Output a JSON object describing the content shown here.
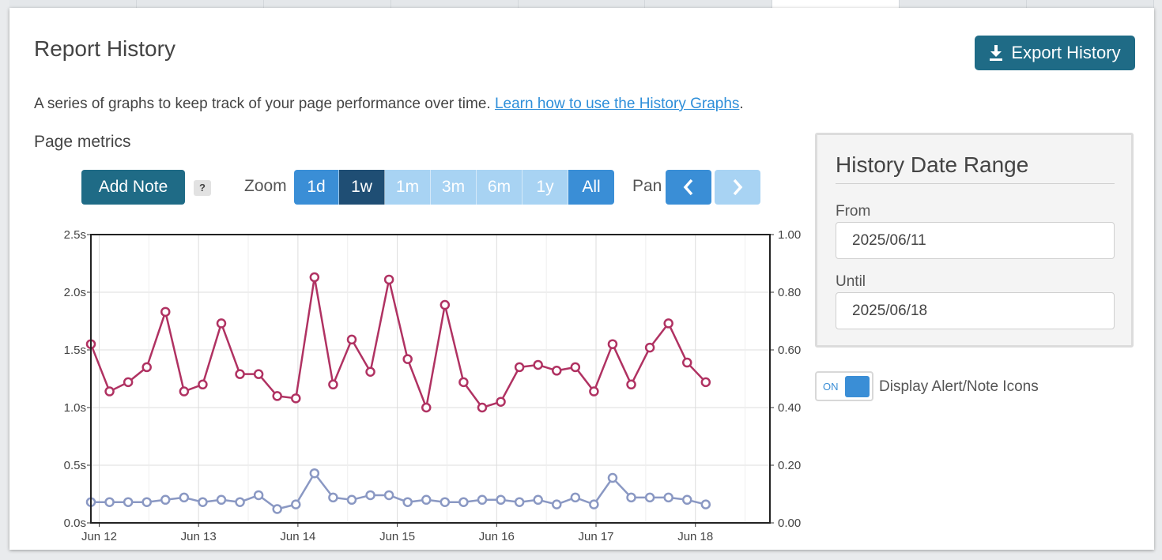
{
  "header": {
    "title": "Report History",
    "export_label": "Export History"
  },
  "intro": {
    "text": "A series of graphs to keep track of your page performance over time. ",
    "link_text": "Learn how to use the History Graphs",
    "trailing": "."
  },
  "section_title": "Page metrics",
  "controls": {
    "add_note_label": "Add Note",
    "help_label": "?",
    "zoom_label": "Zoom",
    "zoom_options": [
      {
        "label": "1d",
        "state": "normal"
      },
      {
        "label": "1w",
        "state": "active"
      },
      {
        "label": "1m",
        "state": "disabled"
      },
      {
        "label": "3m",
        "state": "disabled"
      },
      {
        "label": "6m",
        "state": "disabled"
      },
      {
        "label": "1y",
        "state": "disabled"
      },
      {
        "label": "All",
        "state": "normal"
      }
    ],
    "pan_label": "Pan",
    "pan_prev_icon": "chevron-left-icon",
    "pan_next_icon": "chevron-right-icon"
  },
  "date_range": {
    "title": "History Date Range",
    "from_label": "From",
    "from_value": "2025/06/11",
    "until_label": "Until",
    "until_value": "2025/06/18"
  },
  "toggle": {
    "state_text": "ON",
    "label": "Display Alert/Note Icons"
  },
  "colors": {
    "primary": "#1f6b86",
    "zoom_active": "#1f4e74",
    "zoom_normal": "#3a8ed6",
    "zoom_disabled": "#a8d3f3",
    "pan_disabled": "#a8d3f3",
    "series_primary": "#b03262",
    "series_secondary": "#8a98c3",
    "link": "#2d8ed9"
  },
  "chart_data": {
    "type": "line",
    "x_start": "Jun 11 22:00",
    "x_end": "Jun 18 18:00",
    "x_tick_labels": [
      "Jun 12",
      "Jun 13",
      "Jun 14",
      "Jun 15",
      "Jun 16",
      "Jun 17",
      "Jun 18"
    ],
    "y_left_ticks": [
      "0.0s",
      "0.5s",
      "1.0s",
      "1.5s",
      "2.0s",
      "2.5s"
    ],
    "y_left_range": [
      0,
      2.5
    ],
    "y_right_ticks": [
      "0.00",
      "0.20",
      "0.40",
      "0.60",
      "0.80",
      "1.00"
    ],
    "y_right_range": [
      0,
      1.0
    ],
    "grid": true,
    "legend": "none",
    "x": [
      "Jun 11 22:00",
      "Jun 12 02:30",
      "Jun 12 07:00",
      "Jun 12 11:30",
      "Jun 12 16:00",
      "Jun 12 20:30",
      "Jun 13 01:00",
      "Jun 13 05:30",
      "Jun 13 10:00",
      "Jun 13 14:30",
      "Jun 13 19:00",
      "Jun 13 23:30",
      "Jun 14 04:00",
      "Jun 14 08:30",
      "Jun 14 13:00",
      "Jun 14 17:30",
      "Jun 14 22:00",
      "Jun 15 02:30",
      "Jun 15 07:00",
      "Jun 15 11:30",
      "Jun 15 16:00",
      "Jun 15 20:30",
      "Jun 16 01:00",
      "Jun 16 05:30",
      "Jun 16 10:00",
      "Jun 16 14:30",
      "Jun 16 19:00",
      "Jun 16 23:30",
      "Jun 17 04:00",
      "Jun 17 08:30",
      "Jun 17 13:00",
      "Jun 17 17:30",
      "Jun 17 22:00",
      "Jun 18 02:30",
      "Jun 18 07:00",
      "Jun 18 11:30",
      "Jun 18 16:00",
      "Jun 18 20:30"
    ],
    "series": [
      {
        "axis": "left",
        "color": "#b03262",
        "values": [
          1.55,
          1.14,
          1.22,
          1.35,
          1.83,
          1.14,
          1.2,
          1.73,
          1.29,
          1.29,
          1.1,
          1.08,
          2.13,
          1.2,
          1.59,
          1.31,
          2.11,
          1.42,
          1.0,
          1.89,
          1.22,
          1.0,
          1.05,
          1.35,
          1.37,
          1.32,
          1.35,
          1.14,
          1.55,
          1.2,
          1.52,
          1.73,
          1.39,
          1.22
        ]
      },
      {
        "axis": "left",
        "color": "#8a98c3",
        "values": [
          0.18,
          0.18,
          0.18,
          0.18,
          0.2,
          0.22,
          0.18,
          0.2,
          0.18,
          0.24,
          0.12,
          0.16,
          0.43,
          0.22,
          0.2,
          0.24,
          0.24,
          0.18,
          0.2,
          0.18,
          0.18,
          0.2,
          0.2,
          0.18,
          0.2,
          0.16,
          0.22,
          0.16,
          0.39,
          0.22,
          0.22,
          0.22,
          0.2,
          0.16
        ]
      }
    ]
  }
}
